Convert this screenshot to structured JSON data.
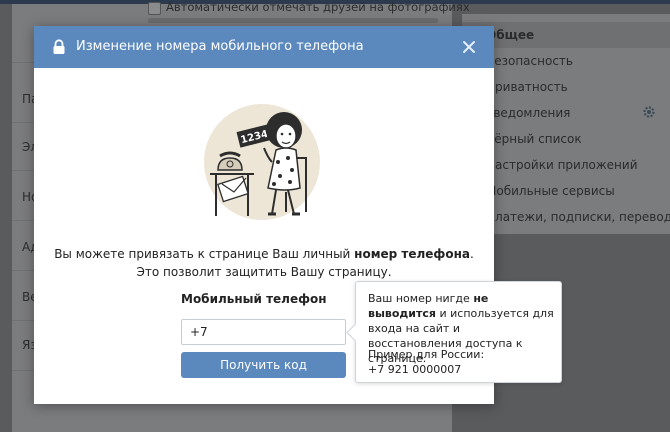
{
  "background": {
    "checkbox_label": "Автоматически отмечать друзей на фотографиях",
    "left_labels": [
      "Па",
      "Эл",
      "Но",
      "Ад",
      "Ве",
      "Яз"
    ],
    "menu": [
      {
        "label": "Общее",
        "active": true
      },
      {
        "label": "Безопасность",
        "active": false
      },
      {
        "label": "Приватность",
        "active": false
      },
      {
        "label": "Уведомления",
        "active": false,
        "icon": "gear-icon"
      },
      {
        "label": "Чёрный список",
        "active": false
      },
      {
        "label": "Настройки приложений",
        "active": false
      },
      {
        "label": "Мобильные сервисы",
        "active": false
      },
      {
        "label": "Платежи, подписки, переводы",
        "active": false
      }
    ]
  },
  "modal": {
    "title": "Изменение номера мобильного телефона",
    "illustration_sign": "1234",
    "description_part1": "Вы можете привязать к странице Ваш личный ",
    "description_bold": "номер телефона",
    "description_part2": ".",
    "description_line2": "Это позволит защитить Вашу страницу.",
    "field_label": "Мобильный телефон",
    "phone_value": "+7",
    "submit_label": "Получить код"
  },
  "tooltip": {
    "text_part1": "Ваш номер нигде ",
    "text_bold": "не выводится",
    "text_part2": " и используется для входа на сайт и восстановления доступа к странице.",
    "example_label": "Пример для России:",
    "example_number": "+7 921 0000007"
  },
  "colors": {
    "header_blue": "#5b88bd",
    "button_blue": "#5b88bd",
    "overlay_gray": "#5a5b5d"
  }
}
